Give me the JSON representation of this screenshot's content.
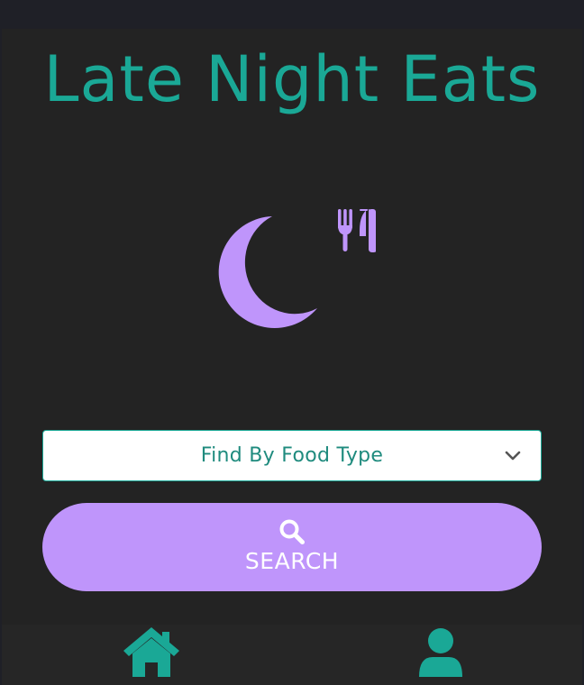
{
  "app": {
    "title": "Late Night Eats"
  },
  "logo": {
    "moon_icon": "moon-icon",
    "utensils_icon": "utensils-icon",
    "color": "#bf95fb"
  },
  "food_type_select": {
    "selected_value": "Find By Food Type",
    "chevron_icon": "chevron-down-icon"
  },
  "search_button": {
    "label": "SEARCH",
    "icon": "search-icon"
  },
  "bottom_nav": {
    "home_icon": "home-icon",
    "profile_icon": "user-icon"
  },
  "colors": {
    "accent": "#1aa896",
    "purple": "#bf95fb",
    "background": "#232323"
  }
}
